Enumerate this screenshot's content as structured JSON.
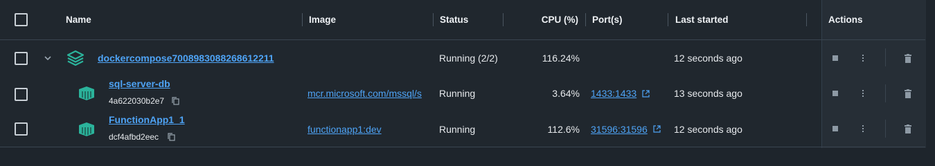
{
  "header": {
    "name": "Name",
    "image": "Image",
    "status": "Status",
    "cpu": "CPU (%)",
    "ports": "Port(s)",
    "last_started": "Last started",
    "actions": "Actions"
  },
  "rows": [
    {
      "name": "dockercompose7008983088268612211",
      "image": "",
      "status": "Running (2/2)",
      "cpu": "116.24%",
      "ports": "",
      "last_started": "12 seconds ago"
    },
    {
      "name": "sql-server-db",
      "id": "4a622030b2e7",
      "image": "mcr.microsoft.com/mssql/s",
      "status": "Running",
      "cpu": "3.64%",
      "ports": "1433:1433",
      "last_started": "13 seconds ago"
    },
    {
      "name": "FunctionApp1_1",
      "id": "dcf4afbd2eec",
      "image": "functionapp1:dev",
      "status": "Running",
      "cpu": "112.6%",
      "ports": "31596:31596",
      "last_started": "12 seconds ago"
    }
  ],
  "colors": {
    "accent": "#4ea3f5",
    "container_icon": "#2bb39b",
    "background": "#20272e"
  },
  "icons": [
    "chevron-down-icon",
    "stack-icon",
    "container-icon",
    "copy-icon",
    "external-link-icon",
    "stop-icon",
    "kebab-menu-icon",
    "trash-icon"
  ]
}
